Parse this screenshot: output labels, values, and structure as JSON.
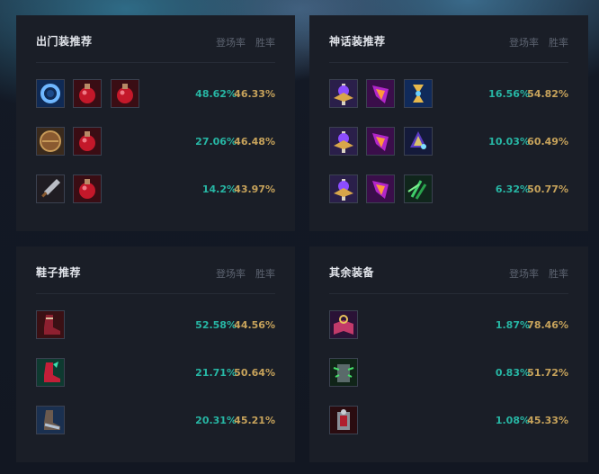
{
  "headers": {
    "pick_rate": "登场率",
    "win_rate": "胜率"
  },
  "starting_items": {
    "title": "出门装推荐",
    "rows": [
      {
        "items": [
          "guardians-orb-icon",
          "health-potion-icon",
          "health-potion-icon"
        ],
        "pick": "48.62%",
        "win": "46.33%"
      },
      {
        "items": [
          "dorans-shield-icon",
          "health-potion-icon"
        ],
        "pick": "27.06%",
        "win": "46.48%"
      },
      {
        "items": [
          "dorans-blade-icon",
          "health-potion-icon"
        ],
        "pick": "14.2%",
        "win": "43.97%"
      }
    ]
  },
  "mythic_items": {
    "title": "神话装推荐",
    "rows": [
      {
        "items": [
          "ludens-tempest-icon",
          "dark-seal-icon",
          "zhonyas-hourglass-icon"
        ],
        "pick": "16.56%",
        "win": "54.82%"
      },
      {
        "items": [
          "ludens-tempest-icon",
          "dark-seal-icon",
          "shadowflame-icon"
        ],
        "pick": "10.03%",
        "win": "60.49%"
      },
      {
        "items": [
          "ludens-tempest-icon",
          "dark-seal-icon",
          "void-staff-icon"
        ],
        "pick": "6.32%",
        "win": "50.77%"
      }
    ]
  },
  "boots": {
    "title": "鞋子推荐",
    "rows": [
      {
        "items": [
          "sorcerers-shoes-icon"
        ],
        "pick": "52.58%",
        "win": "44.56%"
      },
      {
        "items": [
          "mercurys-treads-icon"
        ],
        "pick": "21.71%",
        "win": "50.64%"
      },
      {
        "items": [
          "plated-steelcaps-icon"
        ],
        "pick": "20.31%",
        "win": "45.21%"
      }
    ]
  },
  "other_items": {
    "title": "其余装备",
    "rows": [
      {
        "items": [
          "spellbook-icon"
        ],
        "pick": "1.87%",
        "win": "78.46%"
      },
      {
        "items": [
          "thornmail-icon"
        ],
        "pick": "0.83%",
        "win": "51.72%"
      },
      {
        "items": [
          "armor-item-icon"
        ],
        "pick": "1.08%",
        "win": "45.33%"
      }
    ]
  },
  "colors": {
    "panel_bg": "#1a1e27",
    "page_bg": "#121722",
    "pick_rate": "#27b6a4",
    "win_rate": "#c7a35b",
    "title": "#e3e6ec",
    "header": "#5c6370"
  }
}
